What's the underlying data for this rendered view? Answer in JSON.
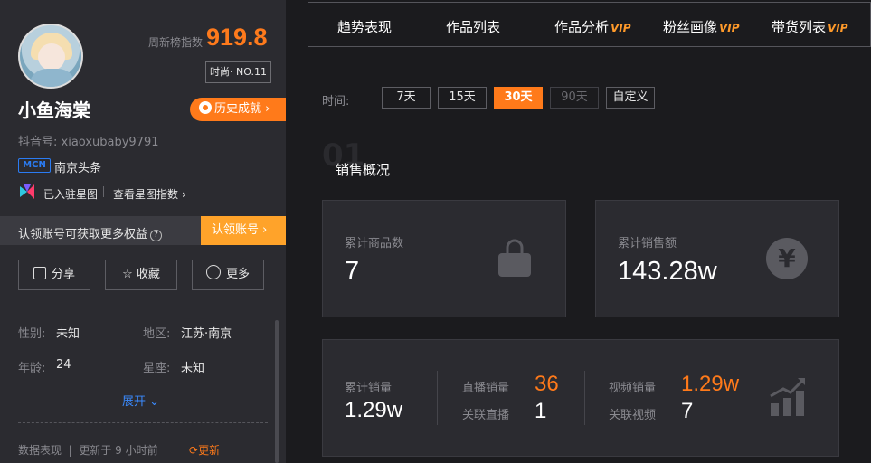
{
  "profile": {
    "score_label": "周新榜指数",
    "score": "919.8",
    "rank_badge": "时尚· NO.11",
    "name": "小鱼海棠",
    "history_button": "历史成就",
    "douyin_id": "抖音号: xiaoxubaby9791",
    "mcn_tag": "MCN",
    "mcn_name": "南京头条",
    "star_joined": "已入驻星图",
    "star_link": "查看星图指数"
  },
  "claim": {
    "text": "认领账号可获取更多权益",
    "button": "认领账号"
  },
  "actions": {
    "share": "分享",
    "favorite": "收藏",
    "more": "更多"
  },
  "info": {
    "gender_label": "性别:",
    "gender_value": "未知",
    "region_label": "地区:",
    "region_value": "江苏·南京",
    "age_label": "年龄:",
    "age_value": "24",
    "zodiac_label": "星座:",
    "zodiac_value": "未知",
    "expand": "展开"
  },
  "footer": {
    "data_label": "数据表现",
    "updated": "更新于 9 小时前",
    "refresh": "更新"
  },
  "tabs": [
    {
      "label": "趋势表现",
      "vip": ""
    },
    {
      "label": "作品列表",
      "vip": ""
    },
    {
      "label": "作品分析",
      "vip": "VIP"
    },
    {
      "label": "粉丝画像",
      "vip": "VIP"
    },
    {
      "label": "带货列表",
      "vip": "VIP"
    }
  ],
  "time_filter": {
    "label": "时间:",
    "options": [
      "7天",
      "15天",
      "30天",
      "90天",
      "自定义"
    ],
    "selected": "30天"
  },
  "section": {
    "number": "01",
    "title": "销售概况"
  },
  "stats": {
    "total_products_label": "累计商品数",
    "total_products": "7",
    "total_sales_amount_label": "累计销售额",
    "total_sales_amount": "143.28w",
    "total_sales_label": "累计销量",
    "total_sales": "1.29w",
    "live_sales_label": "直播销量",
    "live_sales": "36",
    "linked_live_label": "关联直播",
    "linked_live": "1",
    "video_sales_label": "视频销量",
    "video_sales": "1.29w",
    "linked_video_label": "关联视频",
    "linked_video": "7",
    "yen_symbol": "¥"
  },
  "colors": {
    "accent": "#ff7a1a",
    "vip": "#ff9a2a",
    "mcn_blue": "#2b7cf3",
    "link_blue": "#3b8bff"
  }
}
